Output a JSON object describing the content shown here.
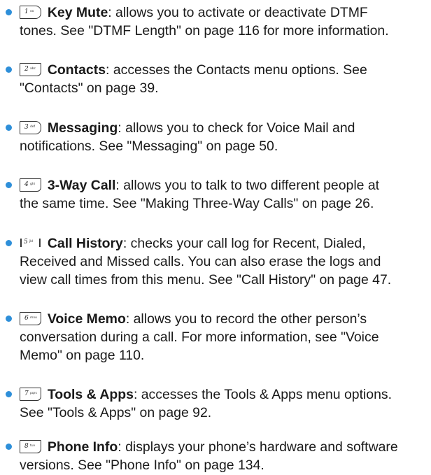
{
  "items": [
    {
      "key_digit": "1",
      "key_letters": "oo",
      "term": "Key Mute",
      "lines": [
        ": allows you to activate or deactivate DTMF",
        "tones. See \"DTMF Length\" on page 116 for more information."
      ]
    },
    {
      "key_digit": "2",
      "key_letters": "abc",
      "term": "Contacts",
      "lines": [
        ": accesses the Contacts menu options. See",
        "\"Contacts\" on page 39."
      ]
    },
    {
      "key_digit": "3",
      "key_letters": "def",
      "term": "Messaging",
      "lines": [
        ": allows you to check for Voice Mail and",
        "notifications. See \"Messaging\" on page 50."
      ]
    },
    {
      "key_digit": "4",
      "key_letters": "ghi",
      "term": "3-Way Call",
      "lines": [
        ": allows you to talk to two different people at",
        "the same time. See \"Making Three-Way Calls\" on page 26."
      ]
    },
    {
      "key_digit": "5",
      "key_letters": "jkl",
      "term": "Call History",
      "lines": [
        ": checks your call log for Recent, Dialed,",
        "Received and Missed calls. You can also erase the logs and",
        "view call times from this menu. See \"Call History\" on page 47."
      ]
    },
    {
      "key_digit": "6",
      "key_letters": "mno",
      "term": "Voice Memo",
      "lines": [
        ": allows you to record the other person’s",
        "conversation during a call. For more information, see \"Voice",
        "Memo\" on page 110."
      ]
    },
    {
      "key_digit": "7",
      "key_letters": "pqrs",
      "term": "Tools & Apps",
      "lines": [
        ": accesses the Tools & Apps menu options.",
        "See \"Tools & Apps\" on page 92."
      ]
    },
    {
      "key_digit": "8",
      "key_letters": "tuv",
      "term": "Phone Info",
      "lines": [
        ": displays your phone’s hardware and software",
        "versions. See \"Phone Info\" on page 134."
      ]
    }
  ]
}
